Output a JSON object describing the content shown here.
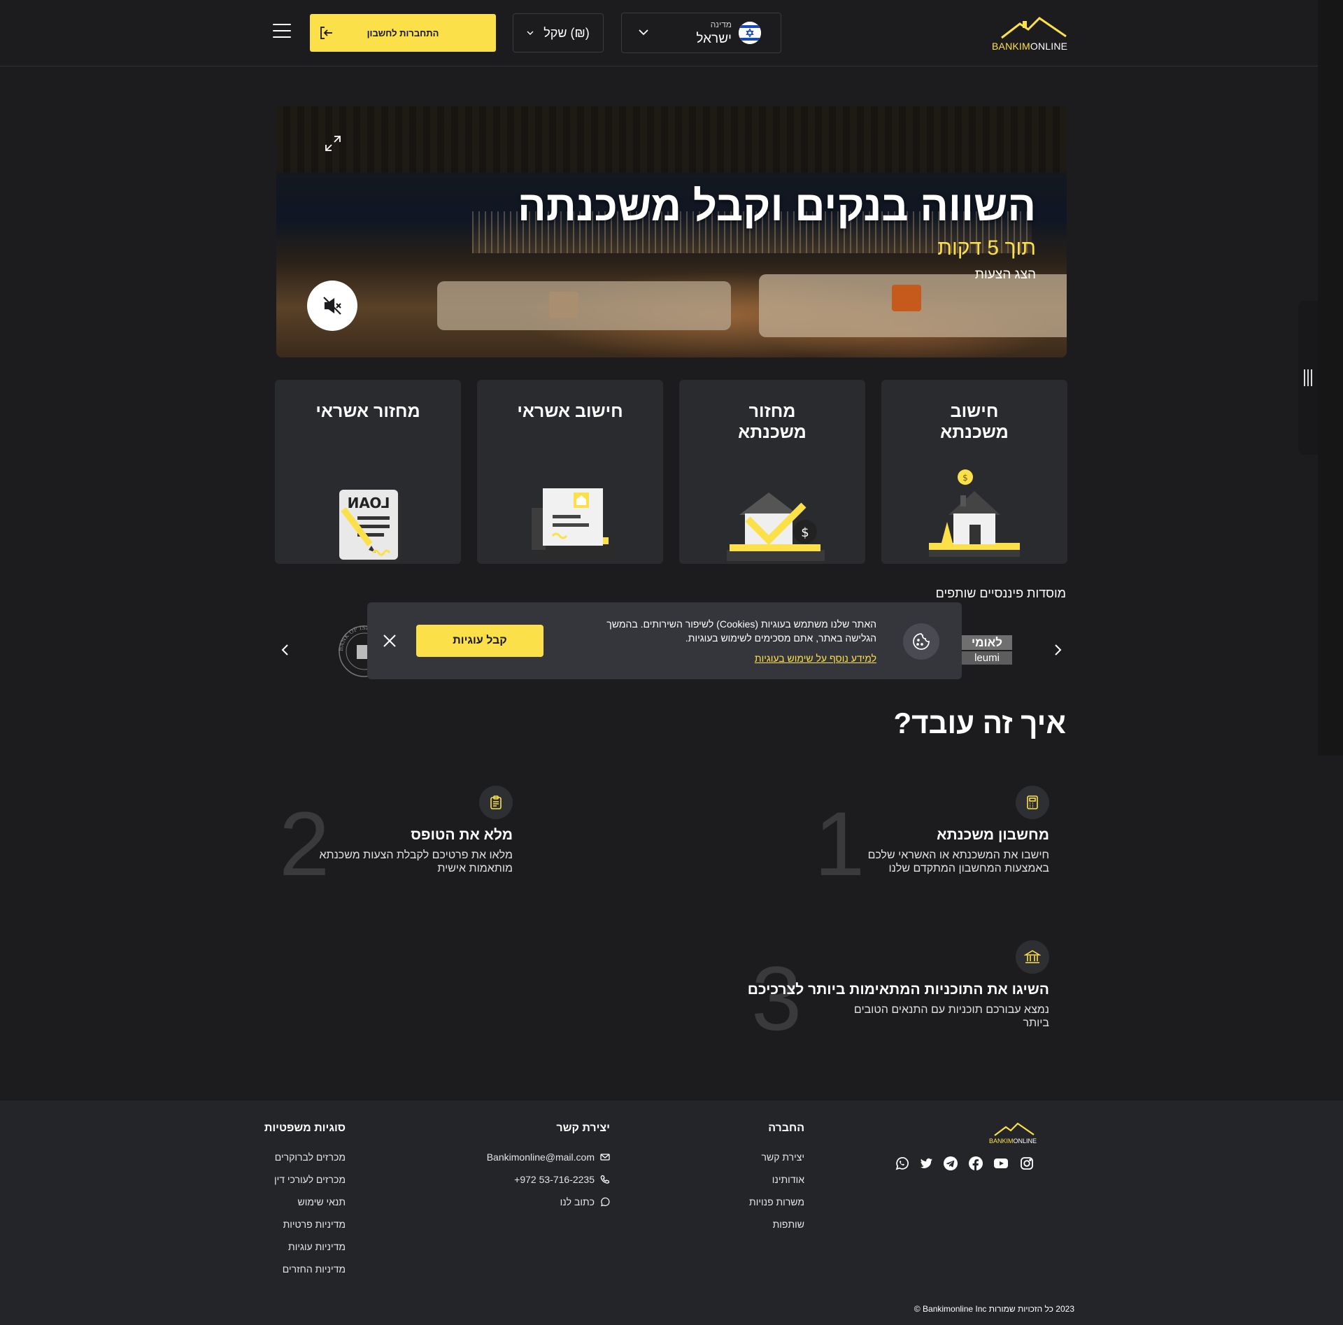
{
  "header": {
    "logo_part1": "BANKIM",
    "logo_part2": "ONLINE",
    "login_label": "התחברות לחשבון",
    "currency_value": "(₪) שקל",
    "country_caption": "מדינה",
    "country_value": "ישראל"
  },
  "hero": {
    "title": "השווה בנקים וקבל משכנתה",
    "subtitle": "תוך 5 דקות",
    "cta": "הצג הצעות"
  },
  "services": [
    {
      "title": "חישוב משכנתא",
      "icon": "house-coin-icon"
    },
    {
      "title": "מחזור משכנתא",
      "icon": "house-refinance-icon"
    },
    {
      "title": "חישוב אשראי",
      "icon": "credit-document-icon"
    },
    {
      "title": "מחזור אשראי",
      "icon": "loan-document-icon"
    }
  ],
  "partners": {
    "title": "מוסדות פיננסיים שותפים",
    "leumi_he": "לאומי",
    "leumi_en": "leumi",
    "boi_text": "BANK OF ISRAEL · בנק ישראל"
  },
  "cookie": {
    "text": "האתר שלנו משתמש בעוגיות (Cookies) לשיפור השירותים. בהמשך הגלישה באתר, אתם מסכימים לשימוש בעוגיות.",
    "link": "למידע נוסף על שימוש בעוגיות",
    "accept": "קבל עוגיות"
  },
  "how": {
    "title": "איך זה עובד?",
    "steps": [
      {
        "num": "1",
        "title": "מחשבון משכנתא",
        "desc": "חישבו את המשכנתא או האשראי שלכם באמצעות המחשבון המתקדם שלנו",
        "icon": "calculator-icon"
      },
      {
        "num": "2",
        "title": "מלא את הטופס",
        "desc": "מלאו את פרטיכם לקבלת הצעות משכנתא מותאמות אישית",
        "icon": "clipboard-icon"
      },
      {
        "num": "3",
        "title": "השיגו את התוכניות המתאימות ביותר לצרכיכם",
        "desc": "נמצא עבורכם תוכניות עם התנאים הטובים ביותר",
        "icon": "bank-icon"
      }
    ]
  },
  "footer": {
    "company": {
      "title": "החברה",
      "links": [
        "יצירת קשר",
        "אודותינו",
        "משרות פנויות",
        "שותפות"
      ]
    },
    "contact": {
      "title": "יצירת קשר",
      "email": "Bankimonline@mail.com",
      "phone": "+972 53-716-2235",
      "write": "כתוב לנו"
    },
    "legal": {
      "title": "סוגיות משפטיות",
      "links": [
        "מכרזים לברוקרים",
        "מכרזים לעורכי דין",
        "תנאי שימוש",
        "מדיניות פרטיות",
        "מדיניות עוגיות",
        "מדיניות החזרים"
      ]
    },
    "social": [
      "instagram-icon",
      "youtube-icon",
      "facebook-icon",
      "telegram-icon",
      "twitter-icon",
      "whatsapp-icon"
    ],
    "copyright": "2023 כל הזכויות שמורות Bankimonline Inc ©"
  },
  "colors": {
    "accent": "#fbe04a",
    "background": "#1c1c1e",
    "card": "#2a2b2f",
    "footer": "#242529"
  }
}
